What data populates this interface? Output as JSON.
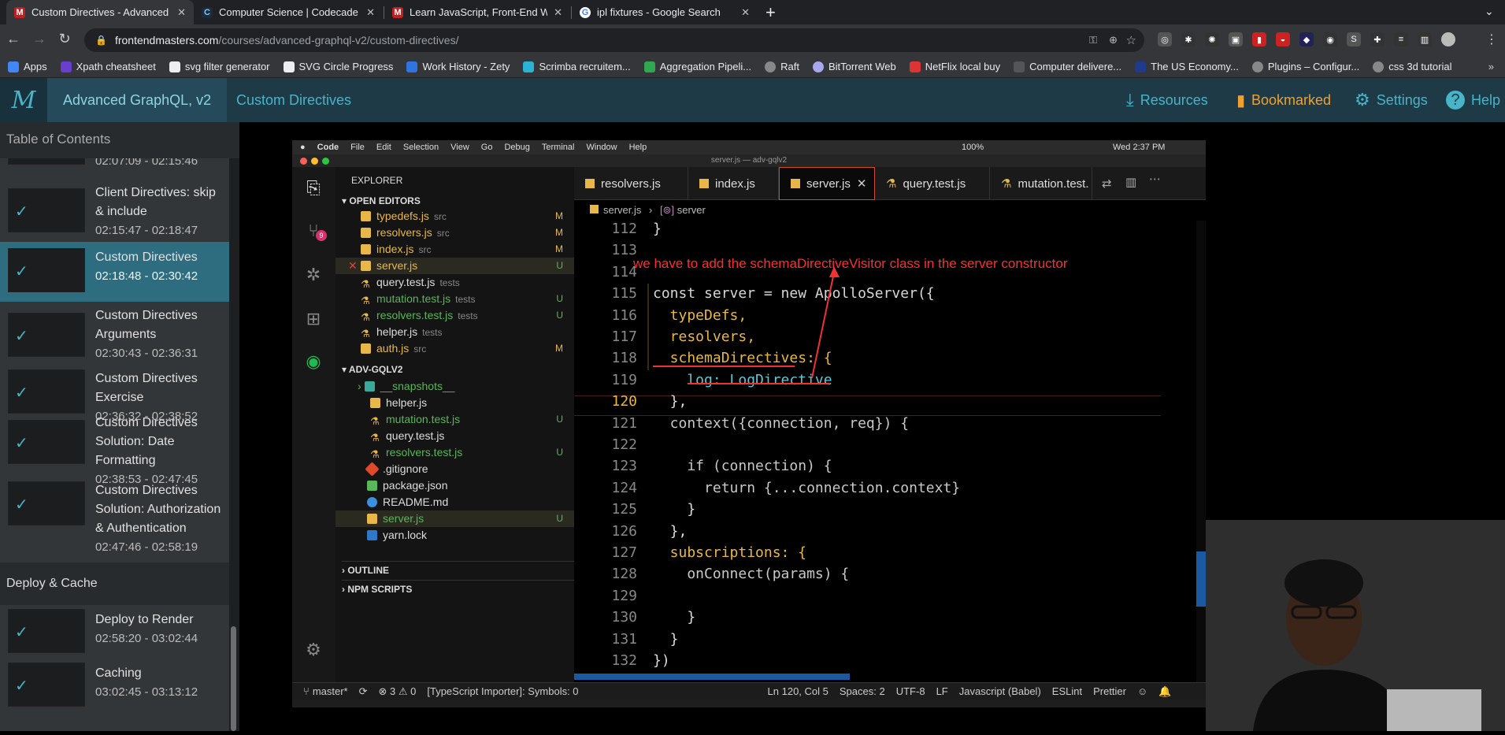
{
  "browser": {
    "tabs": [
      {
        "title": "Custom Directives - Advanced",
        "active": true,
        "favicon": "fm-icon"
      },
      {
        "title": "Computer Science | Codecade",
        "active": false,
        "favicon": "codecademy-icon"
      },
      {
        "title": "Learn JavaScript, Front-End W",
        "active": false,
        "favicon": "fm-icon"
      },
      {
        "title": "ipl fixtures - Google Search",
        "active": false,
        "favicon": "google-icon"
      }
    ],
    "url_host": "frontendmasters.com",
    "url_path": "/courses/advanced-graphql-v2/custom-directives/",
    "bookmarks": [
      "Apps",
      "Xpath cheatsheet",
      "svg filter generator",
      "SVG Circle Progress",
      "Work History - Zety",
      "Scrimba recruitem...",
      "Aggregation Pipeli...",
      "Raft",
      "BitTorrent Web",
      "NetFlix local buy",
      "Computer delivere...",
      "The US Economy...",
      "Plugins – Configur...",
      "css 3d tutorial"
    ]
  },
  "site": {
    "course": "Advanced GraphQL, v2",
    "lesson": "Custom Directives",
    "resources": "Resources",
    "bookmarked": "Bookmarked",
    "settings": "Settings",
    "help": "Help"
  },
  "sidebar": {
    "title": "Table of Contents",
    "lessons": [
      {
        "time": "02:07:09 - 02:15:46",
        "title": ""
      },
      {
        "title": "Client Directives: skip & include",
        "time": "02:15:47 - 02:18:47"
      },
      {
        "title": "Custom Directives",
        "time": "02:18:48 - 02:30:42"
      },
      {
        "title": "Custom Directives Arguments",
        "time": "02:30:43 - 02:36:31"
      },
      {
        "title": "Custom Directives Exercise",
        "time": "02:36:32 - 02:38:52"
      },
      {
        "title": "Custom Directives Solution: Date Formatting",
        "time": "02:38:53 - 02:47:45"
      },
      {
        "title": "Custom Directives Solution: Authorization & Authentication",
        "time": "02:47:46 - 02:58:19"
      }
    ],
    "section": "Deploy & Cache",
    "section_lessons": [
      {
        "title": "Deploy to Render",
        "time": "02:58:20 - 03:02:44"
      },
      {
        "title": "Caching",
        "time": "03:02:45 - 03:13:12"
      }
    ]
  },
  "vscode": {
    "menu": [
      "Code",
      "File",
      "Edit",
      "Selection",
      "View",
      "Go",
      "Debug",
      "Terminal",
      "Window",
      "Help"
    ],
    "menu_right": [
      "100%",
      "Wed 2:37 PM"
    ],
    "window_title": "server.js — adv-gqlv2",
    "explorer_title": "EXPLORER",
    "open_editors_label": "OPEN EDITORS",
    "open_editors": [
      {
        "name": "typedefs.js",
        "dir": "src",
        "status": "M"
      },
      {
        "name": "resolvers.js",
        "dir": "src",
        "status": "M"
      },
      {
        "name": "index.js",
        "dir": "src",
        "status": "M"
      },
      {
        "name": "server.js",
        "dir": "",
        "status": "U"
      },
      {
        "name": "query.test.js",
        "dir": "tests",
        "status": ""
      },
      {
        "name": "mutation.test.js",
        "dir": "tests",
        "status": "U"
      },
      {
        "name": "resolvers.test.js",
        "dir": "tests",
        "status": "U"
      },
      {
        "name": "helper.js",
        "dir": "tests",
        "status": ""
      },
      {
        "name": "auth.js",
        "dir": "src",
        "status": "M"
      }
    ],
    "project_label": "ADV-GQLV2",
    "project_files": [
      {
        "name": "__snapshots__",
        "status": ""
      },
      {
        "name": "helper.js",
        "status": ""
      },
      {
        "name": "mutation.test.js",
        "status": "U"
      },
      {
        "name": "query.test.js",
        "status": ""
      },
      {
        "name": "resolvers.test.js",
        "status": "U"
      },
      {
        "name": ".gitignore",
        "status": ""
      },
      {
        "name": "package.json",
        "status": ""
      },
      {
        "name": "README.md",
        "status": ""
      },
      {
        "name": "server.js",
        "status": "U"
      },
      {
        "name": "yarn.lock",
        "status": ""
      }
    ],
    "outline_label": "OUTLINE",
    "npm_label": "NPM SCRIPTS",
    "scm_badge": "9",
    "editor_tabs": [
      "resolvers.js",
      "index.js",
      "server.js",
      "query.test.js",
      "mutation.test."
    ],
    "breadcrumb": [
      "server.js",
      "server"
    ],
    "code_lines": [
      {
        "n": "112",
        "t": "}"
      },
      {
        "n": "113",
        "t": ""
      },
      {
        "n": "114",
        "t": ""
      },
      {
        "n": "115",
        "t": "const server = new ApolloServer({"
      },
      {
        "n": "116",
        "t": "  typeDefs,"
      },
      {
        "n": "117",
        "t": "  resolvers,"
      },
      {
        "n": "118",
        "t": "  schemaDirectives: {"
      },
      {
        "n": "119",
        "t": "    log: LogDirective"
      },
      {
        "n": "120",
        "t": "  },"
      },
      {
        "n": "121",
        "t": "  context({connection, req}) {"
      },
      {
        "n": "122",
        "t": ""
      },
      {
        "n": "123",
        "t": "    if (connection) {"
      },
      {
        "n": "124",
        "t": "      return {...connection.context}"
      },
      {
        "n": "125",
        "t": "    }"
      },
      {
        "n": "126",
        "t": "  },"
      },
      {
        "n": "127",
        "t": "  subscriptions: {"
      },
      {
        "n": "128",
        "t": "    onConnect(params) {"
      },
      {
        "n": "129",
        "t": ""
      },
      {
        "n": "130",
        "t": "    }"
      },
      {
        "n": "131",
        "t": "  }"
      },
      {
        "n": "132",
        "t": "})"
      }
    ],
    "annotation": "we have to add the schemaDirectiveVisitor class in the server constructor",
    "status": {
      "branch": "master*",
      "problems": "⊗ 3 ⚠ 0",
      "importer": "[TypeScript Importer]: Symbols: 0",
      "position": "Ln 120, Col 5",
      "spaces": "Spaces: 2",
      "encoding": "UTF-8",
      "eol": "LF",
      "language": "Javascript (Babel)",
      "eslint": "ESLint",
      "prettier": "Prettier"
    }
  }
}
